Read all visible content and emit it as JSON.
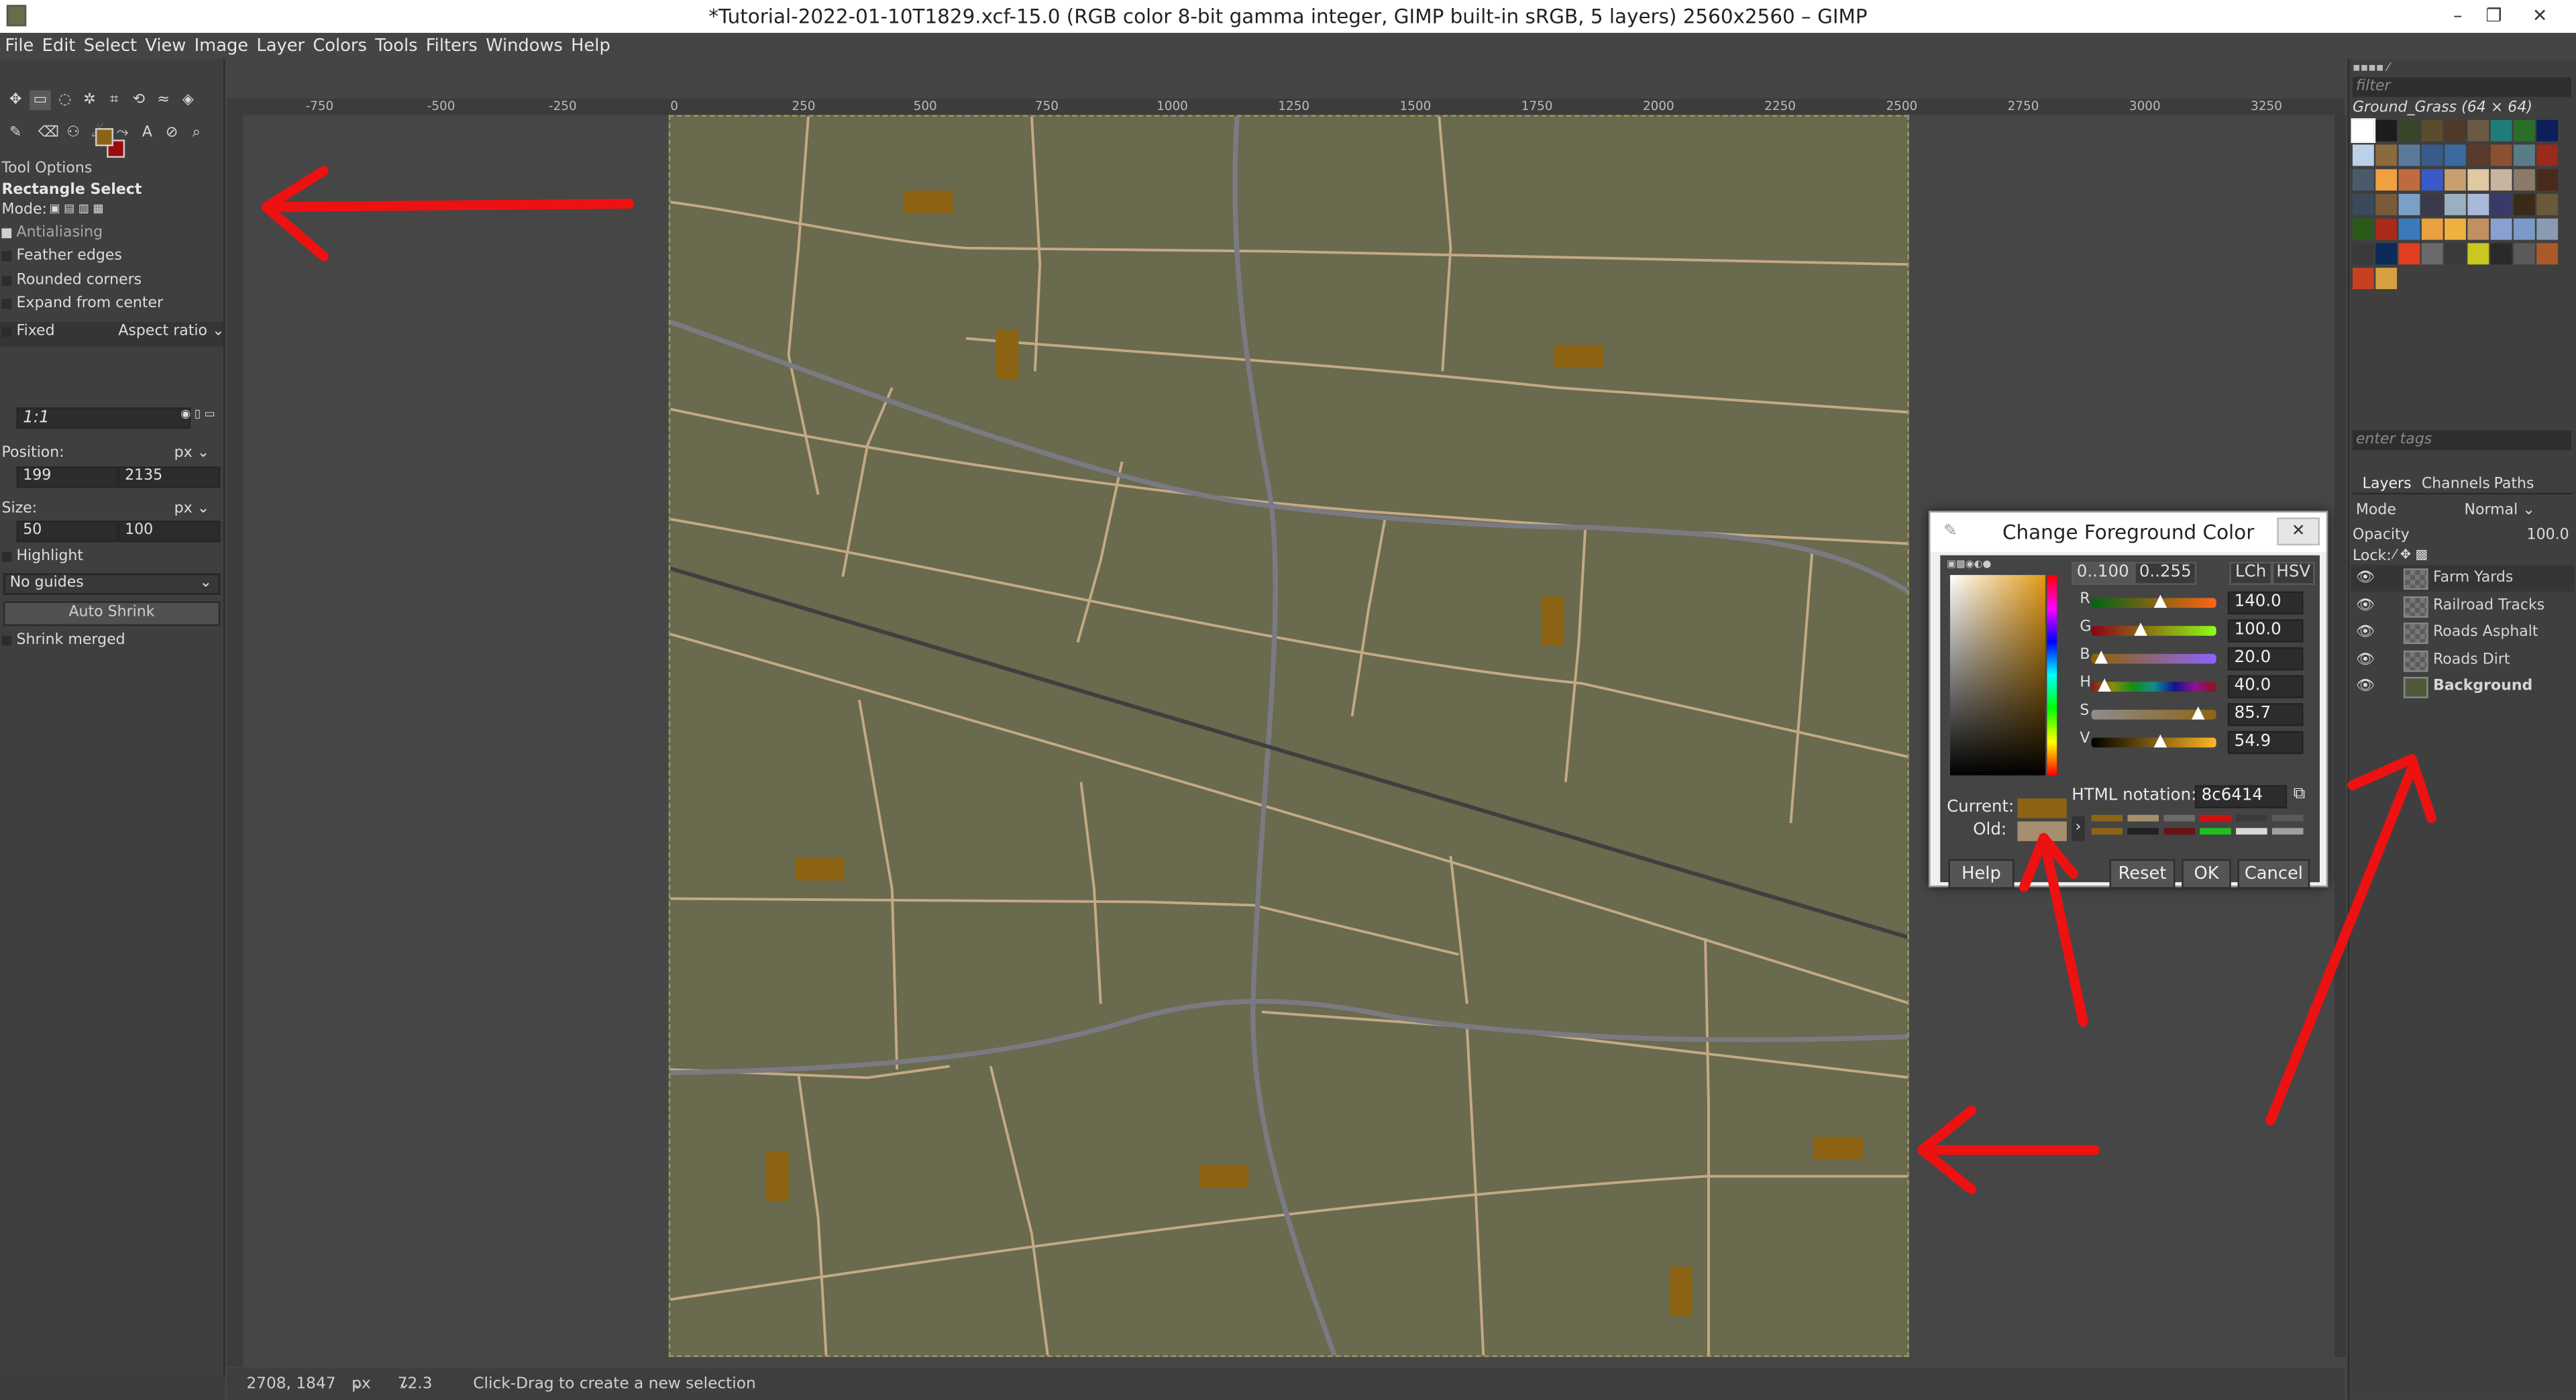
{
  "window": {
    "title": "*Tutorial-2022-01-10T1829.xcf-15.0 (RGB color 8-bit gamma integer, GIMP built-in sRGB, 5 layers) 2560x2560 – GIMP",
    "minimize": "–",
    "maximize": "❐",
    "close": "✕"
  },
  "menu": [
    "File",
    "Edit",
    "Select",
    "View",
    "Image",
    "Layer",
    "Colors",
    "Tools",
    "Filters",
    "Windows",
    "Help"
  ],
  "toolbox": {
    "fg_color": "#8c6414",
    "bg_color": "#9a0c0c"
  },
  "tool_options": {
    "panel_title": "Tool Options",
    "tool_name": "Rectangle Select",
    "mode_label": "Mode:",
    "antialiasing": "Antialiasing",
    "feather_edges": "Feather edges",
    "rounded_corners": "Rounded corners",
    "expand_from_center": "Expand from center",
    "fixed": "Fixed",
    "fixed_select": "Aspect ratio",
    "ratio_value": "1:1",
    "position_label": "Position:",
    "position_unit": "px",
    "position_x": "199",
    "position_y": "2135",
    "size_label": "Size:",
    "size_unit": "px",
    "size_w": "50",
    "size_h": "100",
    "highlight": "Highlight",
    "guides": "No guides",
    "auto_shrink": "Auto Shrink",
    "shrink_merged": "Shrink merged"
  },
  "ruler": {
    "labels": [
      "-750",
      "-500",
      "-250",
      "0",
      "250",
      "500",
      "750",
      "1000",
      "1250",
      "1500",
      "1750",
      "2000",
      "2250",
      "2500",
      "2750",
      "3000",
      "3250"
    ]
  },
  "status": {
    "coords": "2708, 1847",
    "unit": "px",
    "zoom": "72.3 %",
    "message": "Click-Drag to create a new selection"
  },
  "patterns": {
    "filter_placeholder": "filter",
    "current_pattern": "Ground_Grass (64 × 64)",
    "tags_placeholder": "enter tags",
    "colors": [
      "#fff",
      "#1c1c1c",
      "#39452a",
      "#5a4d2c",
      "#4d3a2b",
      "#6a5a44",
      "#1f7c7a",
      "#2b6e2a",
      "#0d1f5a",
      "#bcd0e8",
      "#8a6a3e",
      "#5a7a9a",
      "#3a5a8a",
      "#3a6aa0",
      "#5a3a2a",
      "#8a5030",
      "#5a7c88",
      "#9a2a1a",
      "#4a5a6a",
      "#f0a040",
      "#c06a40",
      "#3a5ac8",
      "#c8a070",
      "#e0c8a0",
      "#c8b4a0",
      "#8a7a6a",
      "#4a2a1a",
      "#3a4a5a",
      "#7a5a3a",
      "#7aa0c8",
      "#3a3a4a",
      "#9ab0c0",
      "#a8b8d8",
      "#3a3a6a",
      "#3a2a1a",
      "#6a5a3a",
      "#2a5a1a",
      "#aa2a1a",
      "#3a7ab8",
      "#e8a040",
      "#f0b040",
      "#c09060",
      "#8aa0d0",
      "#7a9ac8",
      "#8a9ab0",
      "#3a3a3a",
      "#0a2a5a",
      "#e04020",
      "#6a6a6a",
      "#3a3a3a",
      "#c8c820",
      "#2a2a2a",
      "#5a5a5a",
      "#aa5a2a",
      "#c84020",
      "#d4a040"
    ]
  },
  "layers_tabs": {
    "layers": "Layers",
    "channels": "Channels",
    "paths": "Paths"
  },
  "layers_panel": {
    "mode_label": "Mode",
    "mode_value": "Normal",
    "opacity_label": "Opacity",
    "opacity_value": "100.0",
    "lock_label": "Lock:",
    "layers": [
      {
        "name": "Farm Yards",
        "bold": false,
        "selected": true
      },
      {
        "name": "Railroad Tracks",
        "bold": false,
        "selected": false
      },
      {
        "name": "Roads Asphalt",
        "bold": false,
        "selected": false
      },
      {
        "name": "Roads Dirt",
        "bold": false,
        "selected": false
      },
      {
        "name": "Background",
        "bold": true,
        "selected": false
      }
    ]
  },
  "dialog": {
    "title": "Change Foreground Color",
    "range_100": "0..100",
    "range_255": "0..255",
    "lch": "LCh",
    "hsv": "HSV",
    "channels": [
      {
        "label": "R",
        "value": "140.0",
        "fraction": 0.55,
        "gradient": "linear-gradient(to right,#006414,#ff6414)"
      },
      {
        "label": "G",
        "value": "100.0",
        "fraction": 0.39,
        "gradient": "linear-gradient(to right,#8c0014,#8cff14)"
      },
      {
        "label": "B",
        "value": "20.0",
        "fraction": 0.08,
        "gradient": "linear-gradient(to right,#8c6400,#8c64ff)"
      },
      {
        "label": "H",
        "value": "40.0",
        "fraction": 0.11,
        "gradient": "linear-gradient(to right,#8c1414,#8c8c14,#148c14,#148c8c,#14148c,#8c148c,#8c1414)"
      },
      {
        "label": "S",
        "value": "85.7",
        "fraction": 0.86,
        "gradient": "linear-gradient(to right,#8c8c8c,#8c6414)"
      },
      {
        "label": "V",
        "value": "54.9",
        "fraction": 0.55,
        "gradient": "linear-gradient(to right,#000000,#ffb724)"
      }
    ],
    "html_label": "HTML notation:",
    "html_value": "8c6414",
    "current_label": "Current:",
    "old_label": "Old:",
    "current_color": "#8c6414",
    "old_color": "#a58f6e",
    "history": [
      "#8c6414",
      "#a58f6e",
      "#6a6a6a",
      "#d01010",
      "#3a3a3a",
      "#5a5a5a",
      "#8c6414",
      "#222222",
      "#6a1414",
      "#20c020",
      "#d8d8d8",
      "#a0a0a0"
    ],
    "help": "Help",
    "reset": "Reset",
    "ok": "OK",
    "cancel": "Cancel"
  },
  "canvas": {
    "background": "#696a4e",
    "dirt_road": "#c4a985",
    "asphalt_road": "#7a7a82",
    "railroad": "#3f3f3f",
    "farm_yard": "#8c6414"
  },
  "annotations": {
    "arrow_color": "#ee1111"
  }
}
